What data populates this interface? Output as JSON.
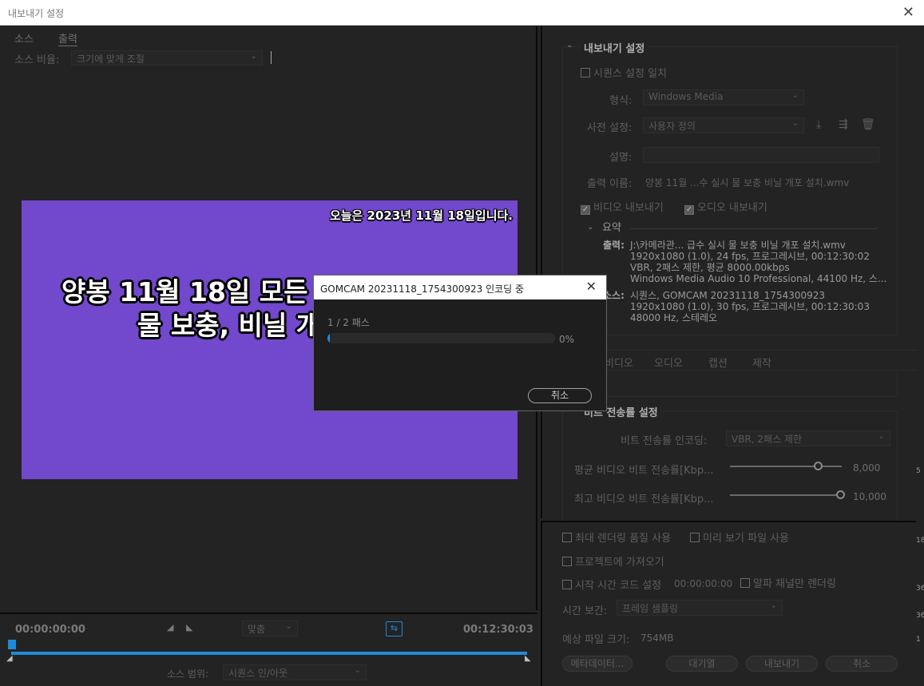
{
  "window": {
    "title": "내보내기 설정"
  },
  "left": {
    "tabs": [
      "소스",
      "출력"
    ],
    "source_ratio_label": "소스 비율:",
    "source_ratio_value": "크기에 맞게 조절",
    "video": {
      "date_text": "오늘은 2023년 11월 18일입니다.",
      "title_line1": "양봉  11월 18일 모든",
      "title_line2": "물 보충, 비닐 개"
    },
    "timeline": {
      "start_tc": "00:00:00:00",
      "end_tc": "00:12:30:03",
      "fit_value": "맞춤",
      "source_range_label": "소스 범위:",
      "source_range_value": "시퀀스 인/아웃"
    }
  },
  "right": {
    "section_title": "내보내기 설정",
    "match_sequence": "시퀀스 설정 일치",
    "format_label": "형식:",
    "format_value": "Windows Media",
    "preset_label": "사전 설정:",
    "preset_value": "사용자 정의",
    "comment_label": "설명:",
    "output_name_label": "출력 이름:",
    "output_name_value": "양봉 11월 ...수 실시 물 보충 비닐 개포 설치.wmv",
    "export_video": "비디오 내보내기",
    "export_audio": "오디오 내보내기",
    "summary_title": "요약",
    "summary_output_label": "출력:",
    "summary_output_lines": [
      "J:\\카메라관... 급수 실시 물 보충 비닐 개포 설치.wmv",
      "1920x1080 (1.0), 24 fps, 프로그레시브, 00:12:30:02",
      "VBR, 2패스 제한, 평균 8000.00kbps",
      "Windows Media Audio 10 Professional, 44100 Hz, 스..."
    ],
    "summary_source_label": "소스:",
    "summary_source_lines": [
      "시퀀스, GOMCAM 20231118_1754300923",
      "1920x1080 (1.0), 30 fps, 프로그레시브, 00:12:30:03",
      "48000 Hz, 스테레오"
    ],
    "subtabs": [
      "비디오",
      "오디오",
      "캡션",
      "제작"
    ],
    "bitrate_section": "비트 전송률 설정",
    "bitrate_encoding_label": "비트 전송률 인코딩:",
    "bitrate_encoding_value": "VBR, 2패스 제한",
    "avg_bitrate_label": "평균 비디오 비트 전송률[Kbp...",
    "avg_bitrate_value": "8,000",
    "max_bitrate_label": "최고 비디오 비트 전송률[Kbp...",
    "max_bitrate_value": "10,000"
  },
  "bottom": {
    "max_render": "최대 렌더링 품질 사용",
    "preview_file": "미리 보기 파일 사용",
    "import_project": "프로젝트에 가져오기",
    "start_tc_label": "시작 시간 코드 설정",
    "start_tc_value": "00:00:00:00",
    "alpha_only": "알파 채널만 렌더링",
    "interp_label": "시간 보간:",
    "interp_value": "프레임 샘플링",
    "est_size_label": "예상 파일 크기:",
    "est_size_value": "754MB",
    "metadata_btn": "메타데이터...",
    "queue_btn": "대기열",
    "export_btn": "내보내기",
    "cancel_btn": "취소"
  },
  "edge_numbers": [
    "5",
    "18",
    "36",
    "36",
    "1"
  ],
  "modal": {
    "title": "GOMCAM 20231118_1754300923 인코딩 중",
    "pass_text": "1 / 2 패스",
    "progress_text": "0%",
    "progress": 0.005,
    "cancel": "취소"
  }
}
